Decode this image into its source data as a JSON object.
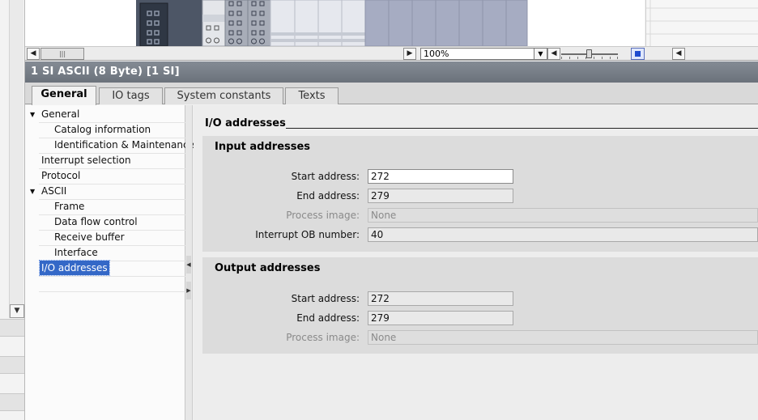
{
  "zoom": {
    "value": "100%"
  },
  "inspector": {
    "title": "1 SI  ASCII  (8 Byte) [1 SI]"
  },
  "tabs": [
    {
      "label": "General"
    },
    {
      "label": "IO tags"
    },
    {
      "label": "System constants"
    },
    {
      "label": "Texts"
    }
  ],
  "nav": [
    {
      "label": "General",
      "expandable": true
    },
    {
      "label": "Catalog information"
    },
    {
      "label": "Identification & Maintenance"
    },
    {
      "label": "Interrupt selection"
    },
    {
      "label": "Protocol"
    },
    {
      "label": "ASCII",
      "expandable": true
    },
    {
      "label": "Frame"
    },
    {
      "label": "Data flow control"
    },
    {
      "label": "Receive buffer"
    },
    {
      "label": "Interface"
    },
    {
      "label": "I/O addresses",
      "selected": true
    }
  ],
  "content": {
    "section_title": "I/O addresses",
    "input": {
      "title": "Input addresses",
      "start_label": "Start address:",
      "start_value": "272",
      "end_label": "End address:",
      "end_value": "279",
      "pi_label": "Process image:",
      "pi_value": "None",
      "ob_label": "Interrupt OB number:",
      "ob_value": "40"
    },
    "output": {
      "title": "Output addresses",
      "start_label": "Start address:",
      "start_value": "272",
      "end_label": "End address:",
      "end_value": "279",
      "pi_label": "Process image:",
      "pi_value": "None"
    }
  },
  "colors": {
    "title_bar": "#767d86",
    "selection": "#3468c7",
    "rack_blue": "#a6acc2",
    "module_dark": "#4d5666"
  }
}
